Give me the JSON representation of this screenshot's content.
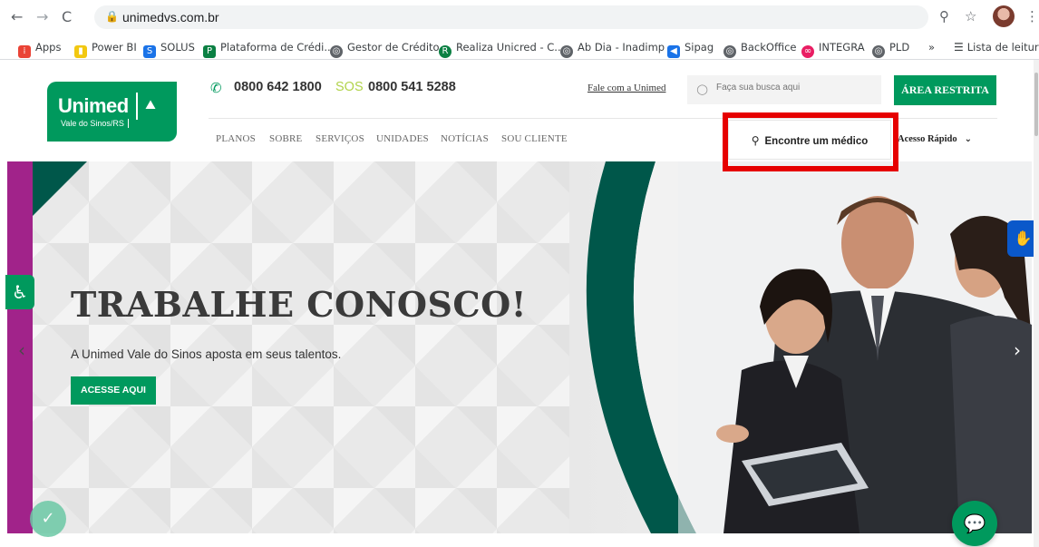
{
  "browser": {
    "url": "unimedvs.com.br",
    "nav": {
      "back": "←",
      "forward": "→",
      "reload": "C"
    },
    "bookmarks": [
      {
        "label": "Apps",
        "icon": "apps-grid-icon",
        "color": "#ea4335"
      },
      {
        "label": "Power BI",
        "icon": "power-bi-icon",
        "color": "#f2c811"
      },
      {
        "label": "SOLUS",
        "icon": "solus-icon",
        "color": "#1a73e8"
      },
      {
        "label": "Plataforma de Crédi...",
        "icon": "plataforma-icon",
        "color": "#0b8043"
      },
      {
        "label": "Gestor de Crédito",
        "icon": "globe-icon",
        "color": "#5f6368"
      },
      {
        "label": "Realiza Unicred - C...",
        "icon": "realiza-icon",
        "color": "#0b8043"
      },
      {
        "label": "Ab Dia - Inadimp",
        "icon": "globe-icon",
        "color": "#5f6368"
      },
      {
        "label": "Sipag",
        "icon": "sipag-icon",
        "color": "#1a73e8"
      },
      {
        "label": "BackOffice",
        "icon": "globe-icon",
        "color": "#5f6368"
      },
      {
        "label": "INTEGRA",
        "icon": "integra-icon",
        "color": "#e91e63"
      },
      {
        "label": "PLD",
        "icon": "globe-icon",
        "color": "#5f6368"
      }
    ],
    "overflow": "»",
    "reading_list": "Lista de leitura"
  },
  "header": {
    "logo_main": "Unimed",
    "logo_sub": "Vale do Sinos/RS",
    "phone_main": "0800 642 1800",
    "sos_label": "SOS",
    "phone_sos": "0800 541 5288",
    "contact_link": "Fale com a Unimed",
    "search_placeholder": "Faça sua busca aqui",
    "restricted_button": "ÁREA RESTRITA",
    "menu": [
      "PLANOS",
      "SOBRE",
      "SERVIÇOS",
      "UNIDADES",
      "NOTÍCIAS",
      "SOU CLIENTE"
    ],
    "find_doctor_button": "Encontre um médico",
    "quick_access": "Acesso Rápido"
  },
  "hero": {
    "title": "TRABALHE CONOSCO!",
    "subtitle": "A Unimed Vale do Sinos aposta em seus talentos.",
    "button": "ACESSE AQUI",
    "prev_arrow": "‹",
    "next_arrow": "›"
  },
  "colors": {
    "brand_green": "#00995d",
    "dark_green": "#00574a",
    "purple": "#a1238a",
    "highlight_red": "#e60000"
  }
}
